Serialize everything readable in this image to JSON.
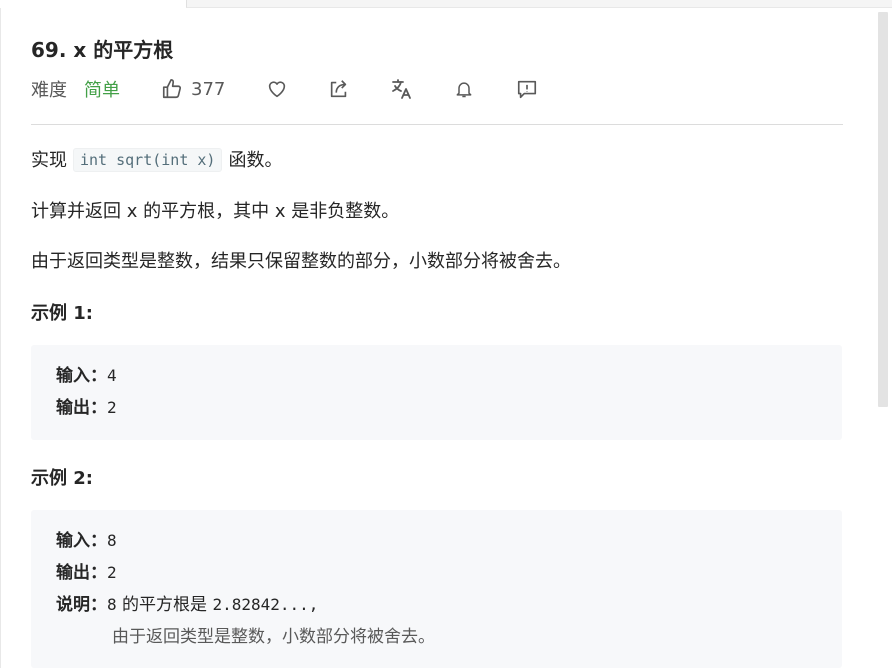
{
  "problem": {
    "title": "69. x 的平方根",
    "difficulty_label": "难度",
    "difficulty_value": "简单",
    "likes": "377"
  },
  "description": {
    "p1_before": "实现",
    "p1_code": "int sqrt(int x)",
    "p1_after": "函数。",
    "p2": "计算并返回 x 的平方根，其中 x 是非负整数。",
    "p3": "由于返回类型是整数，结果只保留整数的部分，小数部分将被舍去。"
  },
  "examples": [
    {
      "heading": "示例 1:",
      "input_label": "输入：",
      "input_value": "4",
      "output_label": "输出：",
      "output_value": "2"
    },
    {
      "heading": "示例 2:",
      "input_label": "输入：",
      "input_value": "8",
      "output_label": "输出：",
      "output_value": "2",
      "explain_label": "说明：",
      "explain_value_a": "8",
      "explain_text_a": "的平方根是",
      "explain_value_b": "2.82842...,",
      "explain_text_b": "由于返回类型是整数，小数部分将被舍去。"
    }
  ],
  "colors": {
    "easy": "#43a047",
    "code_bg": "#f7f8fa"
  },
  "icons": [
    "thumbs-up-icon",
    "heart-icon",
    "share-icon",
    "translate-icon",
    "bell-icon",
    "feedback-icon"
  ]
}
